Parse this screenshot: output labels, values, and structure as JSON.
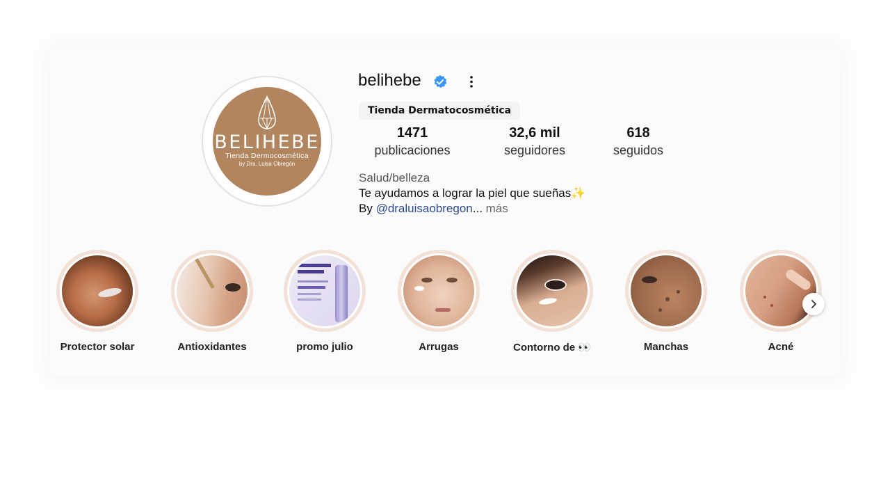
{
  "profile": {
    "username": "belihebe",
    "verified": true,
    "category_pill": "Tienda Dermatocosmética",
    "avatar": {
      "brand": "BELIHEBE",
      "tagline": "Tienda Dermocosmética",
      "byline": "by Dra. Luisa Obregón",
      "color": "#b1855e"
    },
    "stats": [
      {
        "value": "1471",
        "label": "publicaciones"
      },
      {
        "value": "32,6 mil",
        "label": "seguidores"
      },
      {
        "value": "618",
        "label": "seguidos"
      }
    ],
    "bio": {
      "category": "Salud/belleza",
      "line1": "Te ayudamos a lograr la piel que sueñas✨",
      "prefix": "By ",
      "mention": "@draluisaobregon",
      "ellipsis": "...",
      "more": " más"
    }
  },
  "icons": {
    "verified": "verified-badge-icon",
    "options": "more-options-icon",
    "next": "chevron-right-icon"
  },
  "colors": {
    "verified_blue": "#3897f0",
    "mention": "#2d4a8e",
    "highlight_ring": "#f1e1d6"
  },
  "highlights": [
    {
      "label": "Protector solar"
    },
    {
      "label": "Antioxidantes"
    },
    {
      "label": "promo julio"
    },
    {
      "label": "Arrugas"
    },
    {
      "label": "Contorno de 👀"
    },
    {
      "label": "Manchas"
    },
    {
      "label": "Acné"
    }
  ]
}
